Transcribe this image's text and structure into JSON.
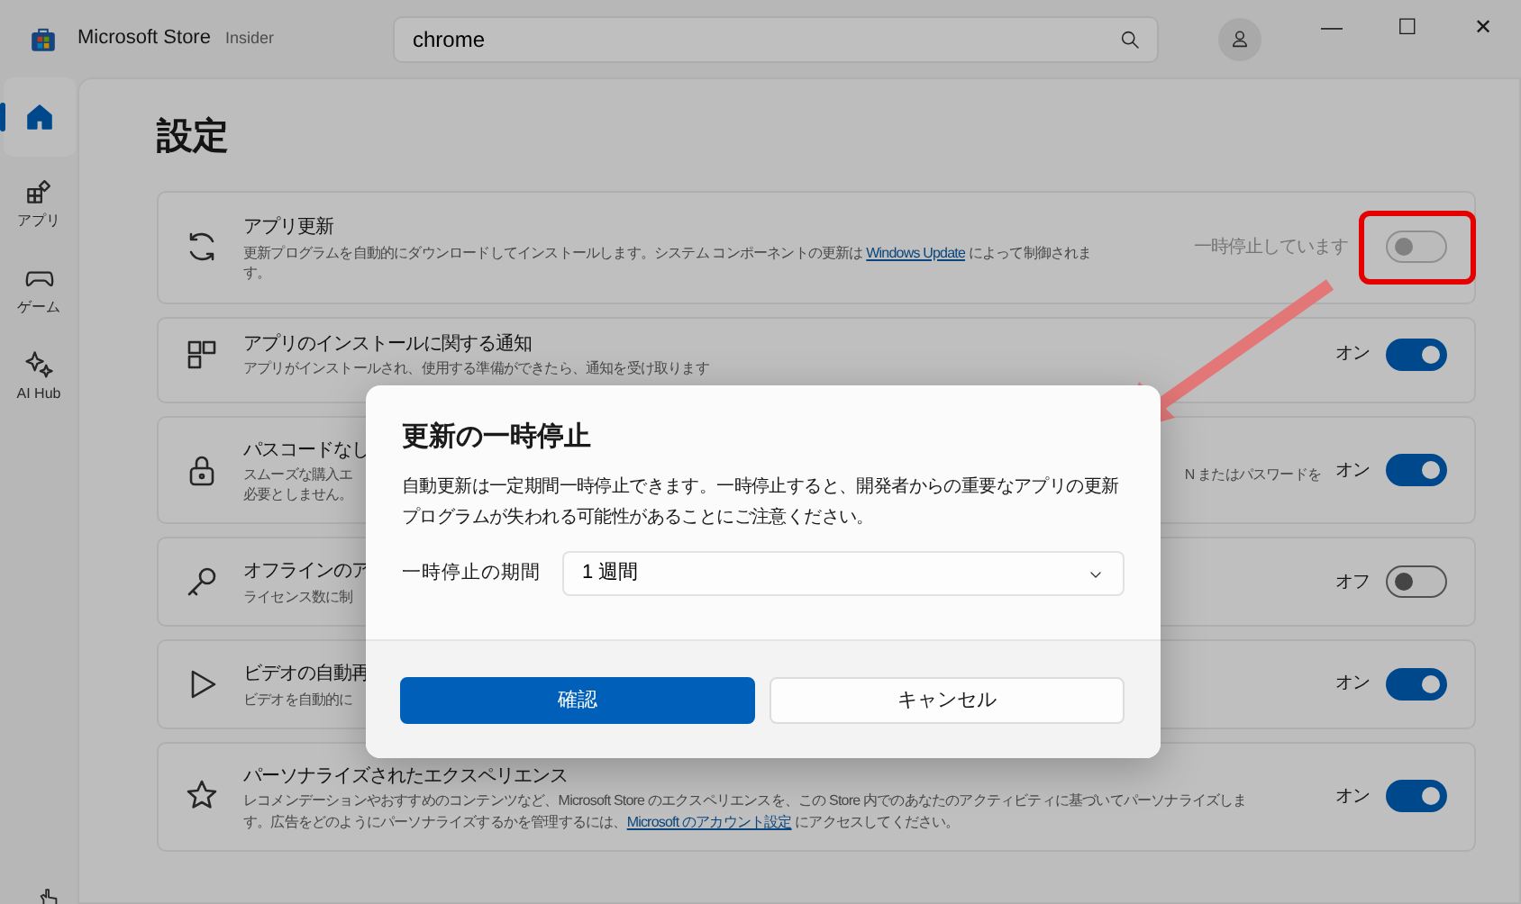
{
  "window": {
    "app_name": "Microsoft Store",
    "badge": "Insider",
    "controls": [
      "—",
      "☐",
      "✕"
    ]
  },
  "search": {
    "value": "chrome"
  },
  "sidebar": {
    "items": [
      {
        "selected": true
      },
      {
        "label": "アプリ",
        "selected": false
      },
      {
        "label": "ゲーム",
        "selected": false
      },
      {
        "label": "AI Hub",
        "selected": false
      }
    ]
  },
  "page": {
    "title": "設定"
  },
  "settings": [
    {
      "title": "アプリ更新",
      "description": [
        [
          {
            "kind": "text",
            "text": "更新プログラムを自動的にダウンロードしてインストールします。システム コンポーネントの更新は "
          },
          {
            "kind": "link",
            "text": "Windows Update"
          },
          {
            "kind": "text",
            "text": " によって制御されま"
          }
        ],
        [
          {
            "kind": "text",
            "text": "す。"
          }
        ]
      ],
      "state_label": "一時停止しています",
      "on": false,
      "disabled": true,
      "highlighted": true
    },
    {
      "title": "アプリのインストールに関する通知",
      "description": [
        [
          {
            "kind": "text",
            "text": "アプリがインストールされ、使用する準備ができたら、通知を受け取ります"
          }
        ]
      ],
      "state_label": "オン",
      "on": true,
      "disabled": false,
      "highlighted": false
    },
    {
      "title": "パスコードなし",
      "description": [
        [
          {
            "kind": "text",
            "text": "スムーズな購入エ"
          },
          {
            "kind": "trailing",
            "text": "N またはパスワードを"
          }
        ],
        [
          {
            "kind": "text",
            "text": "必要としません。"
          }
        ]
      ],
      "state_label": "オン",
      "on": true,
      "disabled": false,
      "highlighted": false
    },
    {
      "title": "オフラインのア",
      "description": [
        [
          {
            "kind": "text",
            "text": "ライセンス数に制"
          }
        ]
      ],
      "state_label": "オフ",
      "on": false,
      "disabled": false,
      "highlighted": false
    },
    {
      "title": "ビデオの自動再",
      "description": [
        [
          {
            "kind": "text",
            "text": "ビデオを自動的に"
          }
        ]
      ],
      "state_label": "オン",
      "on": true,
      "disabled": false,
      "highlighted": false
    },
    {
      "title": "パーソナライズされたエクスペリエンス",
      "description": [
        [
          {
            "kind": "text",
            "text": "レコメンデーションやおすすめのコンテンツなど、Microsoft Store のエクスペリエンスを、この Store 内でのあなたのアクティビティに基づいてパーソナライズしま"
          }
        ],
        [
          {
            "kind": "text",
            "text": "す。広告をどのようにパーソナライズするかを管理するには、"
          },
          {
            "kind": "link",
            "text": "Microsoft のアカウント設定"
          },
          {
            "kind": "text",
            "text": " にアクセスしてください。"
          }
        ]
      ],
      "state_label": "オン",
      "on": true,
      "disabled": false,
      "highlighted": false
    }
  ],
  "dialog": {
    "title": "更新の一時停止",
    "message": "自動更新は一定期間一時停止できます。一時停止すると、開発者からの重要なアプリの更新プログラムが失われる可能性があることにご注意ください。",
    "field_label": "一時停止の期間",
    "field_value": "1 週間",
    "buttons": [
      {
        "label": "確認",
        "kind": "primary"
      },
      {
        "label": "キャンセル",
        "kind": "secondary"
      }
    ]
  }
}
